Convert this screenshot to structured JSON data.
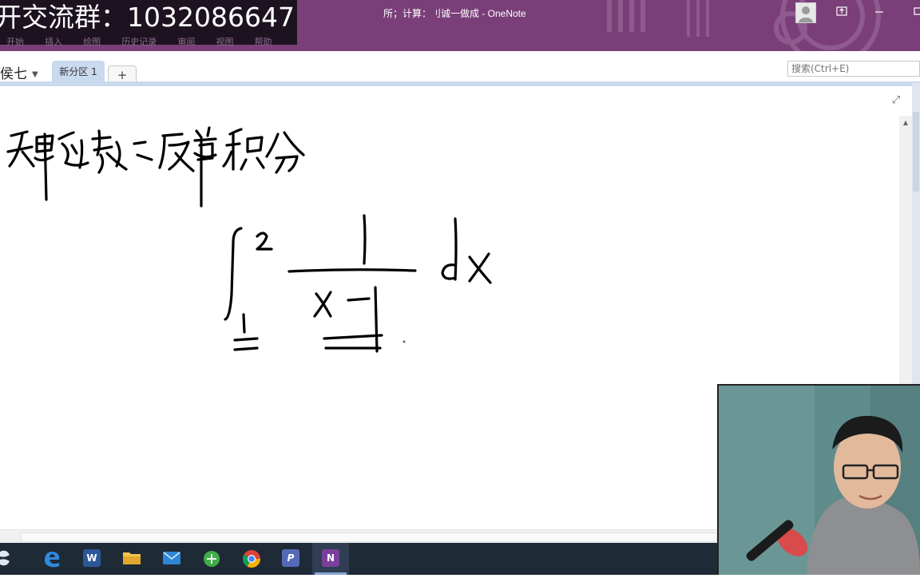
{
  "title_bar": {
    "banner_text": "开交流群：1032086647",
    "window_title": "所；计算：刂诚一做成  -  OneNote",
    "ribbon_tabs": [
      "开始",
      "插入",
      "绘图",
      "历史记录",
      "审阅",
      "视图",
      "帮助"
    ],
    "controls": {
      "user_icon": "user-avatar-icon",
      "ribbon_display_icon": "ribbon-display-icon",
      "minimize_icon": "minimize-icon",
      "maximize_icon": "maximize-icon"
    },
    "accent_color": "#7a3f79"
  },
  "section_bar": {
    "notebook_name": "侯七",
    "section_tab": "新分区 1",
    "add_section": "+",
    "search_placeholder": "搜索(Ctrl+E)"
  },
  "page": {
    "ink_content": "handwritten note: heading in Chinese ink (无界函数之反常积分) and integral from 1 to 2 of 1/(x-1) dx"
  },
  "taskbar": {
    "apps": [
      {
        "name": "start",
        "icon": "windows-start-icon"
      },
      {
        "name": "edge",
        "icon": "edge-icon"
      },
      {
        "name": "word",
        "icon": "word-icon",
        "glyph": "W"
      },
      {
        "name": "file-explorer",
        "icon": "folder-icon"
      },
      {
        "name": "mail",
        "icon": "mail-icon"
      },
      {
        "name": "green-app",
        "icon": "green-circle-icon"
      },
      {
        "name": "chrome",
        "icon": "chrome-icon"
      },
      {
        "name": "powerpoint-like",
        "icon": "p-app-icon",
        "glyph": "P"
      },
      {
        "name": "onenote",
        "icon": "onenote-icon",
        "glyph": "N"
      }
    ]
  }
}
